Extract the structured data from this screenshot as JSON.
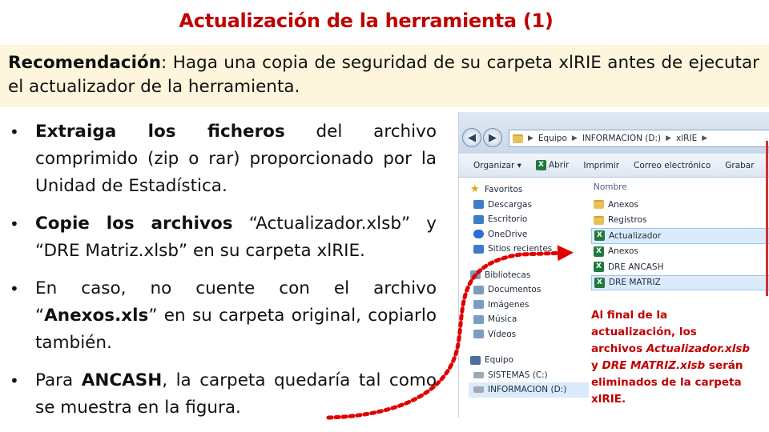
{
  "slide": {
    "title": "Actualización de la herramienta (1)"
  },
  "recommendation": {
    "label": "Recomendación",
    "text": ": Haga una copia de seguridad de su carpeta xlRIE antes de ejecutar el actualizador de la herramienta."
  },
  "bullets": [
    {
      "bold": "Extraiga los ficheros",
      "rest": " del archivo comprimido (zip o rar) proporcionado por la Unidad de Estadística."
    },
    {
      "bold": "Copie los archivos",
      "rest": " “Actualizador.xlsb” y “DRE Matriz.xlsb” en su carpeta xlRIE."
    },
    {
      "pre": "En caso, no cuente con el archivo “",
      "bold": "Anexos.xls",
      "rest": "” en su carpeta original, copiarlo también."
    },
    {
      "pre": "Para ",
      "bold": "ANCASH",
      "rest": ", la carpeta quedaría tal como se muestra en la figura."
    }
  ],
  "explorer": {
    "breadcrumbs": [
      "Equipo",
      "INFORMACION (D:)",
      "xlRIE"
    ],
    "toolbar": [
      "Organizar ▾",
      "Abrir",
      "Imprimir",
      "Correo electrónico",
      "Grabar"
    ],
    "nav": {
      "favorites": "Favoritos",
      "favorite_items": [
        "Descargas",
        "Escritorio",
        "OneDrive",
        "Sitios recientes"
      ],
      "libraries": "Bibliotecas",
      "library_items": [
        "Documentos",
        "Imágenes",
        "Música",
        "Vídeos"
      ],
      "computer": "Equipo",
      "drives": [
        "SISTEMAS (C:)",
        "INFORMACION (D:)"
      ]
    },
    "column_header": "Nombre",
    "files": [
      {
        "name": "Anexos",
        "kind": "folder"
      },
      {
        "name": "Registros",
        "kind": "folder"
      },
      {
        "name": "Actualizador",
        "kind": "excel"
      },
      {
        "name": "Anexos",
        "kind": "excel"
      },
      {
        "name": "DRE ANCASH",
        "kind": "excel"
      },
      {
        "name": "DRE MATRIZ",
        "kind": "excel"
      }
    ]
  },
  "note": {
    "line1": "Al final de la actualización, los archivos ",
    "italic": "Actualizador.xlsb",
    "line2": " y ",
    "italic2": "DRE MATRIZ.xlsb",
    "line3": " serán eliminados de la carpeta xlRIE."
  },
  "colors": {
    "title": "#c00000",
    "box": "#fdf5dc",
    "arrow": "#e00000"
  }
}
